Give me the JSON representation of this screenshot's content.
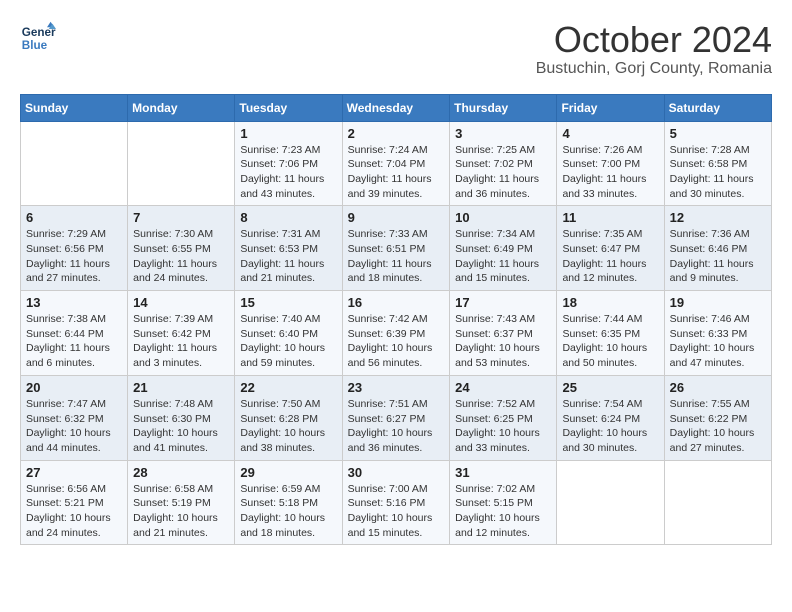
{
  "header": {
    "logo_line1": "General",
    "logo_line2": "Blue",
    "month": "October 2024",
    "location": "Bustuchin, Gorj County, Romania"
  },
  "days_of_week": [
    "Sunday",
    "Monday",
    "Tuesday",
    "Wednesday",
    "Thursday",
    "Friday",
    "Saturday"
  ],
  "weeks": [
    [
      {
        "day": "",
        "sunrise": "",
        "sunset": "",
        "daylight": ""
      },
      {
        "day": "",
        "sunrise": "",
        "sunset": "",
        "daylight": ""
      },
      {
        "day": "1",
        "sunrise": "Sunrise: 7:23 AM",
        "sunset": "Sunset: 7:06 PM",
        "daylight": "Daylight: 11 hours and 43 minutes."
      },
      {
        "day": "2",
        "sunrise": "Sunrise: 7:24 AM",
        "sunset": "Sunset: 7:04 PM",
        "daylight": "Daylight: 11 hours and 39 minutes."
      },
      {
        "day": "3",
        "sunrise": "Sunrise: 7:25 AM",
        "sunset": "Sunset: 7:02 PM",
        "daylight": "Daylight: 11 hours and 36 minutes."
      },
      {
        "day": "4",
        "sunrise": "Sunrise: 7:26 AM",
        "sunset": "Sunset: 7:00 PM",
        "daylight": "Daylight: 11 hours and 33 minutes."
      },
      {
        "day": "5",
        "sunrise": "Sunrise: 7:28 AM",
        "sunset": "Sunset: 6:58 PM",
        "daylight": "Daylight: 11 hours and 30 minutes."
      }
    ],
    [
      {
        "day": "6",
        "sunrise": "Sunrise: 7:29 AM",
        "sunset": "Sunset: 6:56 PM",
        "daylight": "Daylight: 11 hours and 27 minutes."
      },
      {
        "day": "7",
        "sunrise": "Sunrise: 7:30 AM",
        "sunset": "Sunset: 6:55 PM",
        "daylight": "Daylight: 11 hours and 24 minutes."
      },
      {
        "day": "8",
        "sunrise": "Sunrise: 7:31 AM",
        "sunset": "Sunset: 6:53 PM",
        "daylight": "Daylight: 11 hours and 21 minutes."
      },
      {
        "day": "9",
        "sunrise": "Sunrise: 7:33 AM",
        "sunset": "Sunset: 6:51 PM",
        "daylight": "Daylight: 11 hours and 18 minutes."
      },
      {
        "day": "10",
        "sunrise": "Sunrise: 7:34 AM",
        "sunset": "Sunset: 6:49 PM",
        "daylight": "Daylight: 11 hours and 15 minutes."
      },
      {
        "day": "11",
        "sunrise": "Sunrise: 7:35 AM",
        "sunset": "Sunset: 6:47 PM",
        "daylight": "Daylight: 11 hours and 12 minutes."
      },
      {
        "day": "12",
        "sunrise": "Sunrise: 7:36 AM",
        "sunset": "Sunset: 6:46 PM",
        "daylight": "Daylight: 11 hours and 9 minutes."
      }
    ],
    [
      {
        "day": "13",
        "sunrise": "Sunrise: 7:38 AM",
        "sunset": "Sunset: 6:44 PM",
        "daylight": "Daylight: 11 hours and 6 minutes."
      },
      {
        "day": "14",
        "sunrise": "Sunrise: 7:39 AM",
        "sunset": "Sunset: 6:42 PM",
        "daylight": "Daylight: 11 hours and 3 minutes."
      },
      {
        "day": "15",
        "sunrise": "Sunrise: 7:40 AM",
        "sunset": "Sunset: 6:40 PM",
        "daylight": "Daylight: 10 hours and 59 minutes."
      },
      {
        "day": "16",
        "sunrise": "Sunrise: 7:42 AM",
        "sunset": "Sunset: 6:39 PM",
        "daylight": "Daylight: 10 hours and 56 minutes."
      },
      {
        "day": "17",
        "sunrise": "Sunrise: 7:43 AM",
        "sunset": "Sunset: 6:37 PM",
        "daylight": "Daylight: 10 hours and 53 minutes."
      },
      {
        "day": "18",
        "sunrise": "Sunrise: 7:44 AM",
        "sunset": "Sunset: 6:35 PM",
        "daylight": "Daylight: 10 hours and 50 minutes."
      },
      {
        "day": "19",
        "sunrise": "Sunrise: 7:46 AM",
        "sunset": "Sunset: 6:33 PM",
        "daylight": "Daylight: 10 hours and 47 minutes."
      }
    ],
    [
      {
        "day": "20",
        "sunrise": "Sunrise: 7:47 AM",
        "sunset": "Sunset: 6:32 PM",
        "daylight": "Daylight: 10 hours and 44 minutes."
      },
      {
        "day": "21",
        "sunrise": "Sunrise: 7:48 AM",
        "sunset": "Sunset: 6:30 PM",
        "daylight": "Daylight: 10 hours and 41 minutes."
      },
      {
        "day": "22",
        "sunrise": "Sunrise: 7:50 AM",
        "sunset": "Sunset: 6:28 PM",
        "daylight": "Daylight: 10 hours and 38 minutes."
      },
      {
        "day": "23",
        "sunrise": "Sunrise: 7:51 AM",
        "sunset": "Sunset: 6:27 PM",
        "daylight": "Daylight: 10 hours and 36 minutes."
      },
      {
        "day": "24",
        "sunrise": "Sunrise: 7:52 AM",
        "sunset": "Sunset: 6:25 PM",
        "daylight": "Daylight: 10 hours and 33 minutes."
      },
      {
        "day": "25",
        "sunrise": "Sunrise: 7:54 AM",
        "sunset": "Sunset: 6:24 PM",
        "daylight": "Daylight: 10 hours and 30 minutes."
      },
      {
        "day": "26",
        "sunrise": "Sunrise: 7:55 AM",
        "sunset": "Sunset: 6:22 PM",
        "daylight": "Daylight: 10 hours and 27 minutes."
      }
    ],
    [
      {
        "day": "27",
        "sunrise": "Sunrise: 6:56 AM",
        "sunset": "Sunset: 5:21 PM",
        "daylight": "Daylight: 10 hours and 24 minutes."
      },
      {
        "day": "28",
        "sunrise": "Sunrise: 6:58 AM",
        "sunset": "Sunset: 5:19 PM",
        "daylight": "Daylight: 10 hours and 21 minutes."
      },
      {
        "day": "29",
        "sunrise": "Sunrise: 6:59 AM",
        "sunset": "Sunset: 5:18 PM",
        "daylight": "Daylight: 10 hours and 18 minutes."
      },
      {
        "day": "30",
        "sunrise": "Sunrise: 7:00 AM",
        "sunset": "Sunset: 5:16 PM",
        "daylight": "Daylight: 10 hours and 15 minutes."
      },
      {
        "day": "31",
        "sunrise": "Sunrise: 7:02 AM",
        "sunset": "Sunset: 5:15 PM",
        "daylight": "Daylight: 10 hours and 12 minutes."
      },
      {
        "day": "",
        "sunrise": "",
        "sunset": "",
        "daylight": ""
      },
      {
        "day": "",
        "sunrise": "",
        "sunset": "",
        "daylight": ""
      }
    ]
  ]
}
